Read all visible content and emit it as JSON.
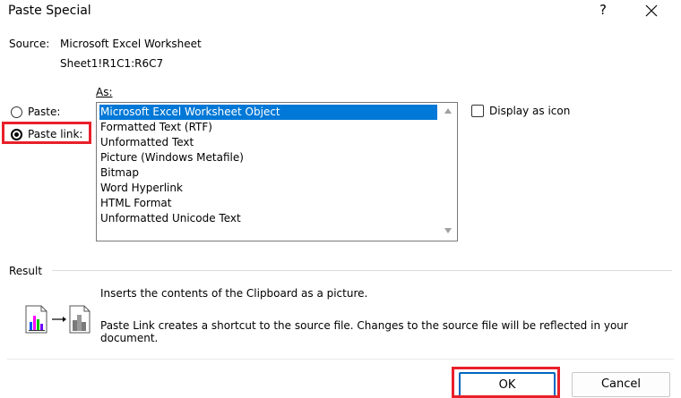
{
  "dialog": {
    "title": "Paste Special",
    "help_label": "?"
  },
  "source": {
    "label": "Source:",
    "value": "Microsoft Excel Worksheet",
    "range": "Sheet1!R1C1:R6C7"
  },
  "as_label": "As:",
  "options": {
    "paste_label": "Paste:",
    "paste_link_label": "Paste link:",
    "selected": "paste_link"
  },
  "formats": {
    "items": [
      "Microsoft Excel Worksheet Object",
      "Formatted Text (RTF)",
      "Unformatted Text",
      "Picture (Windows Metafile)",
      "Bitmap",
      "Word Hyperlink",
      "HTML Format",
      "Unformatted Unicode Text"
    ],
    "selected_index": 0
  },
  "display_as_icon": {
    "label": "Display as icon",
    "checked": false
  },
  "result": {
    "label": "Result",
    "line1": "Inserts the contents of the Clipboard as a picture.",
    "line2": "Paste Link creates a shortcut to the source file. Changes to the source file will be reflected in your document."
  },
  "buttons": {
    "ok": "OK",
    "cancel": "Cancel"
  },
  "colors": {
    "selection": "#0078d7",
    "highlight_box": "#e8202a"
  }
}
